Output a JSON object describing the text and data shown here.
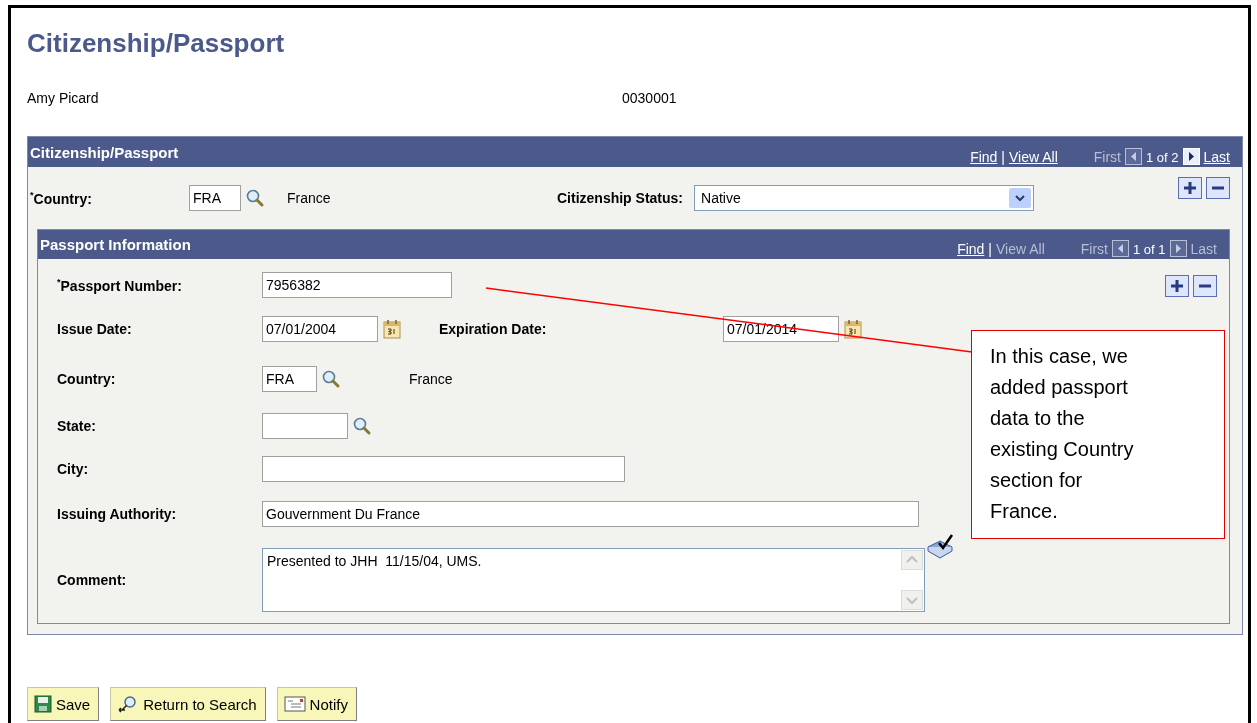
{
  "page_title": "Citizenship/Passport",
  "employee": {
    "name": "Amy Picard",
    "id": "0030001"
  },
  "citizenship_section": {
    "title": "Citizenship/Passport",
    "nav": {
      "links": [
        {
          "kind": "link",
          "text": "Find",
          "enabled": true
        },
        {
          "kind": "sep",
          "text": "|"
        },
        {
          "kind": "link",
          "text": "View All",
          "enabled": true
        }
      ],
      "paging": [
        {
          "kind": "link",
          "text": "First",
          "enabled": false
        },
        {
          "kind": "prev",
          "enabled": false
        },
        {
          "kind": "count",
          "text": "1 of 2"
        },
        {
          "kind": "next",
          "enabled": true
        },
        {
          "kind": "link",
          "text": "Last",
          "enabled": true
        }
      ]
    },
    "country": {
      "label": "$^{*}$Country:",
      "value": "FRA",
      "description": "France"
    },
    "status": {
      "label": "Citizenship Status:",
      "value": "Native"
    },
    "passport_section": {
      "title": "Passport Information",
      "nav": {
        "links": [
          {
            "kind": "link",
            "text": "Find",
            "enabled": true
          },
          {
            "kind": "sep",
            "text": "|"
          },
          {
            "kind": "link",
            "text": "View All",
            "enabled": false
          }
        ],
        "paging": [
          {
            "kind": "link",
            "text": "First",
            "enabled": false
          },
          {
            "kind": "prev",
            "enabled": false
          },
          {
            "kind": "count",
            "text": "1 of 1"
          },
          {
            "kind": "next",
            "enabled": false
          },
          {
            "kind": "link",
            "text": "Last",
            "enabled": false
          }
        ]
      },
      "rows": [
        {
          "fields": [
            {
              "kind": "text",
              "label": "$^{*}$Passport Number:",
              "value": "7956382"
            }
          ]
        },
        {
          "fields": [
            {
              "kind": "date",
              "label": "Issue Date:",
              "value": "07/01/2004"
            },
            {
              "kind": "date",
              "label": "Expiration Date:",
              "value": "07/01/2014"
            }
          ]
        },
        {
          "fields": [
            {
              "kind": "lookup",
              "label": "Country:",
              "value": "FRA",
              "description": "France"
            }
          ]
        },
        {
          "fields": [
            {
              "kind": "lookup",
              "label": "State:"
            }
          ]
        },
        {
          "fields": [
            {
              "kind": "text",
              "label": "City:"
            }
          ]
        },
        {
          "fields": [
            {
              "kind": "text",
              "label": "Issuing Authority:",
              "value": "Gouvernment Du France"
            }
          ]
        },
        {
          "fields": [
            {
              "kind": "textarea",
              "label": "Comment:",
              "value": "Presented to JHH  11/15/04, UMS."
            }
          ]
        }
      ]
    }
  },
  "callout": {
    "text": "In this case, we added passport data to the existing Country section for France."
  },
  "buttons": [
    {
      "kind": "save",
      "label": "Save"
    },
    {
      "kind": "search",
      "label": "Return to Search"
    },
    {
      "kind": "notify",
      "label": "Notify"
    }
  ]
}
